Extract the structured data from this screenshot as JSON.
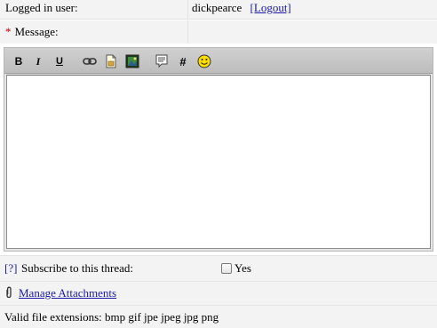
{
  "user_row": {
    "label": "Logged in user:",
    "username": "dickpearce",
    "logout_link": "[Logout]"
  },
  "message_row": {
    "required_marker": "*",
    "label": "Message:"
  },
  "toolbar": {
    "bold": "B",
    "italic": "I",
    "underline": "U",
    "hash": "#",
    "icons": [
      "bold-icon",
      "italic-icon",
      "underline-icon",
      "link-icon",
      "document-icon",
      "image-icon",
      "quote-icon",
      "hash-icon",
      "smiley-icon"
    ]
  },
  "editor": {
    "value": ""
  },
  "subscribe_row": {
    "help_link": "[?]",
    "label": "Subscribe to this thread:",
    "checkbox_label": "Yes",
    "checked": false
  },
  "attachments_row": {
    "link": "Manage Attachments"
  },
  "extensions_row": {
    "label": "Valid file extensions: bmp gif jpe jpeg jpg png"
  },
  "colors": {
    "link": "#1a1aa8",
    "required": "#cc0000",
    "row_bg": "#f3f3f3",
    "toolbar_bg": "#c6c6c6"
  }
}
